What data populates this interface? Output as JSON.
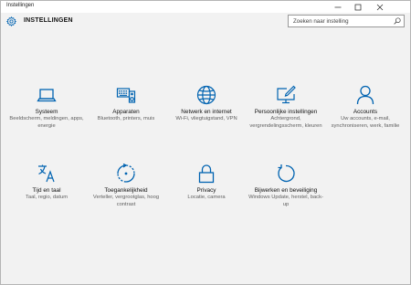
{
  "window": {
    "title": "Instellingen",
    "minimize_icon": "minimize-icon",
    "maximize_icon": "maximize-icon",
    "close_icon": "close-icon"
  },
  "header": {
    "icon": "gear-icon",
    "title": "INSTELLINGEN",
    "search_placeholder": "Zoeken naar instelling",
    "search_icon": "search-icon"
  },
  "accent": "#0063b1",
  "tiles": [
    {
      "icon": "laptop-icon",
      "name": "Systeem",
      "desc": "Beeldscherm, meldingen, apps, energie"
    },
    {
      "icon": "keyboard-speaker-icon",
      "name": "Apparaten",
      "desc": "Bluetooth, printers, muis"
    },
    {
      "icon": "globe-icon",
      "name": "Netwerk en internet",
      "desc": "Wi-Fi, vliegtuigstand, VPN"
    },
    {
      "icon": "monitor-pen-icon",
      "name": "Persoonlijke instellingen",
      "desc": "Achtergrond, vergrendelingsscherm, kleuren"
    },
    {
      "icon": "person-icon",
      "name": "Accounts",
      "desc": "Uw accounts, e-mail, synchroniseren, werk, familie"
    },
    {
      "icon": "time-language-icon",
      "name": "Tijd en taal",
      "desc": "Taal, regio, datum"
    },
    {
      "icon": "ease-of-access-icon",
      "name": "Toegankelijkheid",
      "desc": "Verteller, vergrootglas, hoog contrast"
    },
    {
      "icon": "lock-icon",
      "name": "Privacy",
      "desc": "Locatie, camera"
    },
    {
      "icon": "update-icon",
      "name": "Bijwerken en beveiliging",
      "desc": "Windows Update, herstel, back-up"
    }
  ]
}
